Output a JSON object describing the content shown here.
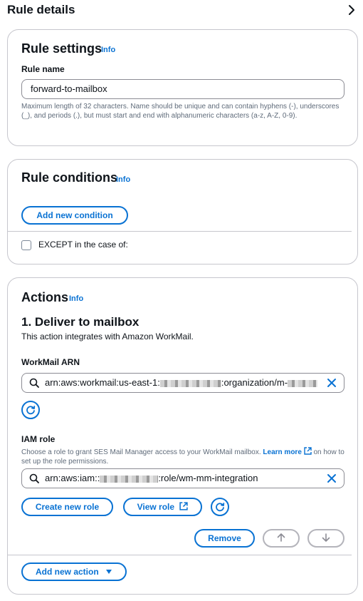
{
  "panel": {
    "title": "Rule details"
  },
  "rule_settings": {
    "title": "Rule settings",
    "info": "Info",
    "rule_name_label": "Rule name",
    "rule_name_value": "forward-to-mailbox",
    "rule_name_hint": "Maximum length of 32 characters. Name should be unique and can contain hyphens (-), underscores (_), and periods (.), but must start and end with alphanumeric characters (a-z, A-Z, 0-9)."
  },
  "rule_conditions": {
    "title": "Rule conditions",
    "info": "Info",
    "add_condition_label": "Add new condition",
    "except_label": "EXCEPT in the case of:",
    "except_checked": false
  },
  "actions": {
    "title": "Actions",
    "info": "Info",
    "action_title": "1. Deliver to mailbox",
    "action_description": "This action integrates with Amazon WorkMail.",
    "workmail_arn_label": "WorkMail ARN",
    "workmail_arn_prefix": "arn:aws:workmail:us-east-1:",
    "workmail_arn_middle": ":organization/m-",
    "iam_role_label": "IAM role",
    "iam_role_hint_text": "Choose a role to grant SES Mail Manager access to your WorkMail mailbox.",
    "iam_role_hint_link": "Learn more",
    "iam_role_hint_rest": "on how to set up the role permissions.",
    "iam_role_prefix": "arn:aws:iam::",
    "iam_role_suffix": ":role/wm-mm-integration",
    "create_role_label": "Create new role",
    "view_role_label": "View role",
    "remove_label": "Remove",
    "add_action_label": "Add new action"
  },
  "icons": {
    "chevron": "chevron-right-icon",
    "search": "search-icon",
    "clear": "close-icon",
    "refresh": "refresh-icon",
    "external": "external-link-icon",
    "up": "arrow-up-icon",
    "down": "arrow-down-icon",
    "caret": "caret-down-icon"
  },
  "colors": {
    "accent": "#0972d3",
    "border": "#c6c6cd",
    "text": "#0f141a",
    "muted": "#5f6b7a",
    "disabled": "#b4b4bb"
  }
}
